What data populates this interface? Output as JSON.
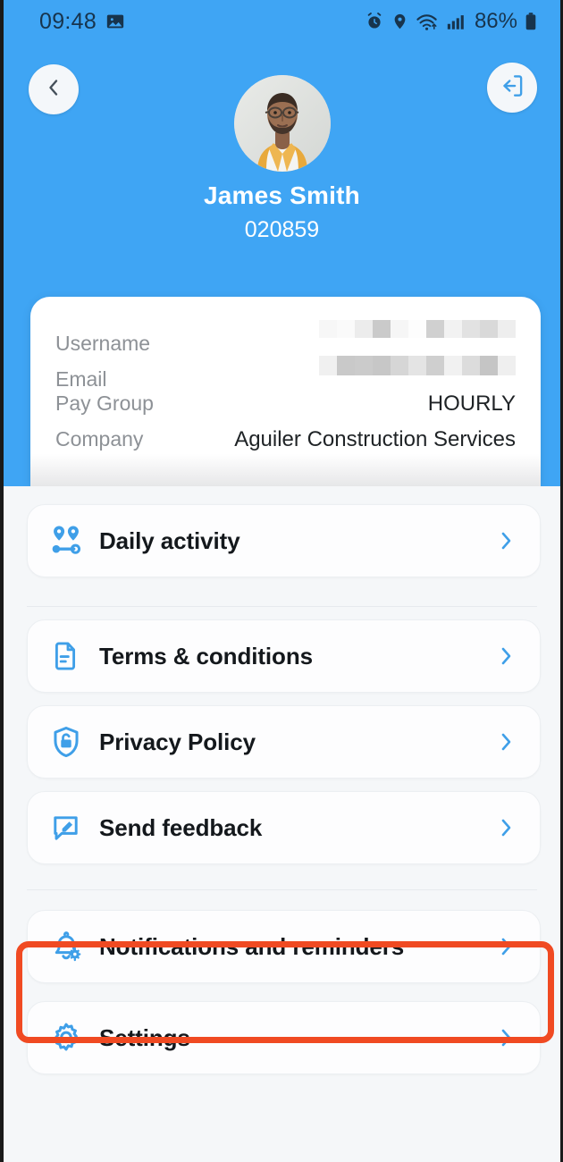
{
  "statusbar": {
    "time": "09:48",
    "battery_percent": "86%",
    "icons": [
      "gallery-image-icon",
      "alarm-icon",
      "location-icon",
      "wifi-icon",
      "cellular-signal-icon",
      "battery-icon"
    ]
  },
  "header": {
    "back_icon": "chevron-left-icon",
    "logout_icon": "logout-icon",
    "avatar_icon": "user-avatar-photo",
    "user_name": "James Smith",
    "user_id": "020859",
    "accent_color": "#3FA5F4"
  },
  "info_card": {
    "rows": [
      {
        "label": "Username",
        "value": "",
        "redacted": true
      },
      {
        "label": "Email",
        "value": "",
        "redacted": true
      },
      {
        "label": "Pay Group",
        "value": "HOURLY",
        "redacted": false
      },
      {
        "label": "Company",
        "value": "Aguiler Construction Services",
        "redacted": false
      }
    ]
  },
  "menu": {
    "chevron_icon": "chevron-right-icon",
    "icon_color": "#3F9FE8",
    "groups": [
      {
        "items": [
          {
            "label": "Daily activity",
            "icon": "map-route-pins-icon"
          }
        ]
      },
      {
        "items": [
          {
            "label": "Terms & conditions",
            "icon": "document-icon"
          },
          {
            "label": "Privacy Policy",
            "icon": "shield-lock-icon"
          },
          {
            "label": "Send feedback",
            "icon": "feedback-pencil-icon"
          }
        ]
      },
      {
        "items": [
          {
            "label": "Notifications and reminders",
            "icon": "bell-gear-icon",
            "highlighted": true
          },
          {
            "label": "Settings",
            "icon": "gear-icon"
          }
        ]
      }
    ]
  },
  "annotation": {
    "target_label": "Notifications and reminders",
    "color": "#F04A22"
  }
}
